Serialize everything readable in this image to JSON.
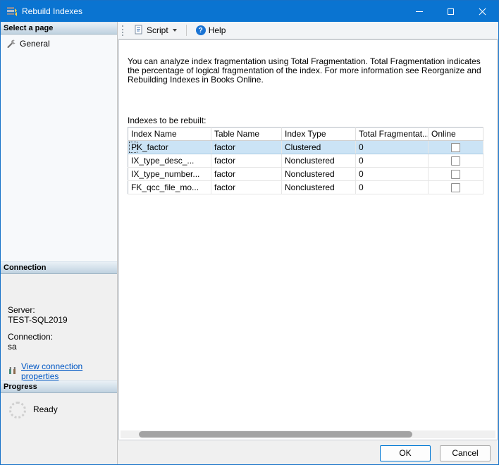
{
  "window": {
    "title": "Rebuild Indexes"
  },
  "sidebar": {
    "select_page": {
      "header": "Select a page",
      "items": [
        {
          "label": "General"
        }
      ]
    },
    "connection": {
      "header": "Connection",
      "server_label": "Server:",
      "server_value": "TEST-SQL2019",
      "connection_label": "Connection:",
      "connection_value": "sa",
      "link": "View connection properties"
    },
    "progress": {
      "header": "Progress",
      "status": "Ready"
    }
  },
  "toolbar": {
    "script_label": "Script",
    "help_label": "Help",
    "help_glyph": "?"
  },
  "main": {
    "description": "You can analyze index fragmentation using Total Fragmentation. Total Fragmentation indicates the percentage of logical fragmentation of the index. For more information see Reorganize and Rebuilding Indexes in Books Online.",
    "table_label": "Indexes to be rebuilt:",
    "table": {
      "columns": [
        "Index Name",
        "Table Name",
        "Index Type",
        "Total Fragmentat...",
        "Online"
      ],
      "rows": [
        {
          "index_name": "PK_factor",
          "table_name": "factor",
          "index_type": "Clustered",
          "total_fragmentation": "0",
          "online": false,
          "selected": true
        },
        {
          "index_name": "IX_type_desc_...",
          "table_name": "factor",
          "index_type": "Nonclustered",
          "total_fragmentation": "0",
          "online": false,
          "selected": false
        },
        {
          "index_name": "IX_type_number...",
          "table_name": "factor",
          "index_type": "Nonclustered",
          "total_fragmentation": "0",
          "online": false,
          "selected": false
        },
        {
          "index_name": "FK_qcc_file_mo...",
          "table_name": "factor",
          "index_type": "Nonclustered",
          "total_fragmentation": "0",
          "online": false,
          "selected": false
        }
      ]
    }
  },
  "footer": {
    "ok_label": "OK",
    "cancel_label": "Cancel"
  },
  "colors": {
    "titlebar": "#0a74d1",
    "accent": "#0078d4",
    "selected_row": "#cbe3f5",
    "link": "#0057c4",
    "panel_header_top": "#e9f0f6",
    "panel_header_bottom": "#bfd2e0"
  }
}
